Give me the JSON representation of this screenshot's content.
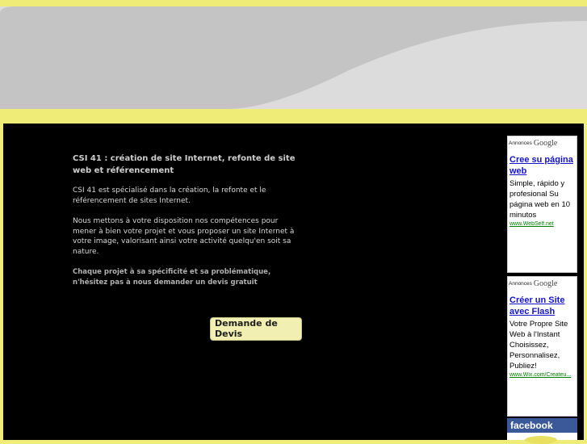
{
  "content": {
    "title": "CSI 41 : création de site Internet, refonte de   site web et référencement",
    "paragraph1": "CSI 41 est spécialisé dans la création, la refonte et le   référencement de sites Internet.",
    "paragraph2": "Nous mettons à votre disposition nos compétences pour   mener à bien votre projet et vous proposer un site   Internet à votre image, valorisant ainsi votre activité   quelqu'en soit sa nature.",
    "paragraph3": "Chaque projet à sa spécificité et sa problématique,   n'hésitez pas à nous demander un devis gratuit",
    "devis_button": "Demande de Devis"
  },
  "ads": [
    {
      "header_label": "Annonces",
      "header_brand": "Google",
      "link": "Cree su página web",
      "text": "Simple, rápido y profesional Su página web en 10 minutos",
      "url": "www.WebSelf.net"
    },
    {
      "header_label": "Annonces",
      "header_brand": "Google",
      "link": "Créer un Site avec Flash",
      "text": "Votre Propre Site Web à l'Instant Choisissez, Personnalisez, Publiez!",
      "url": "www.Wix.com/Createu..."
    }
  ],
  "facebook": {
    "label": "facebook"
  },
  "colors": {
    "background": "#f0ec78",
    "main_panel": "#000000",
    "facebook_blue": "#3b5998",
    "ad_link": "#1414cc",
    "ad_url": "#008000"
  }
}
